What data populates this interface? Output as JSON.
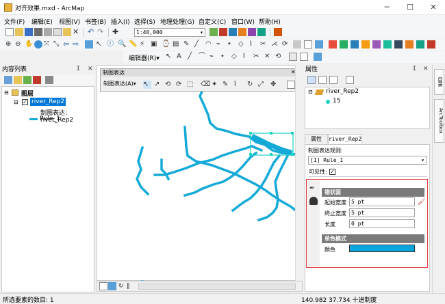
{
  "window": {
    "title": "对齐效果.mxd - ArcMap"
  },
  "menu": [
    "文件(F)",
    "编辑(E)",
    "视图(V)",
    "书签(B)",
    "插入(I)",
    "选择(S)",
    "地理处理(G)",
    "自定义(C)",
    "窗口(W)",
    "帮助(H)"
  ],
  "toolbar": {
    "scale": "1:40,000",
    "editor_label": "编辑器(R)▾"
  },
  "toc": {
    "title": "内容列表",
    "root": "图层",
    "layer": "river_Rep2",
    "rep_label": "制图表达: river_Rep2",
    "rule": "Rule_1"
  },
  "rep_toolbar": {
    "title": "制图表达",
    "menu": "制图表达(A)▾"
  },
  "attr": {
    "title": "属性",
    "tree_layer": "river_Rep2",
    "tree_value": "15",
    "tab_props": "属性",
    "tab_layer": "river_Rep2",
    "rule_label": "制图表达规则:",
    "rule_value": "[1] Rule_1",
    "visible_label": "可见性:",
    "visible_check": "✓",
    "stroke_section": "错状面",
    "start_width_label": "起始宽度",
    "start_width": "5 pt",
    "end_width_label": "终止宽度",
    "end_width": "5 pt",
    "length_label": "长度",
    "length": "0 pt",
    "color_section": "单色模式",
    "color_label": "颜色",
    "color_value": "#0aa5dc"
  },
  "side_tabs": [
    "目录",
    "ArcToolbox"
  ],
  "status": {
    "left": "所选要素的数目: 1",
    "coords": "140.982  37.734 十进制度"
  },
  "colors": {
    "river": "#14aad8",
    "highlight": "#0078d7",
    "selection": "#19d3c5",
    "red_box": "#e03a3a"
  }
}
